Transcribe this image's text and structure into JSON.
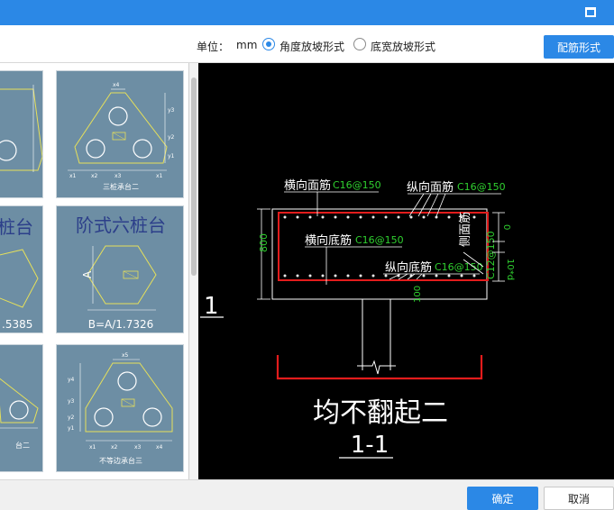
{
  "toolbar": {
    "unit_label": "单位：",
    "unit_value": "mm",
    "option_angle": "角度放坡形式",
    "option_width": "底宽放坡形式",
    "rebar_form_button": "配筋形式"
  },
  "thumbnails": [
    {
      "caption": "",
      "title": ""
    },
    {
      "caption": "三桩承台二",
      "title": ""
    },
    {
      "caption": "",
      "title": "桩台",
      "formula": ".5385"
    },
    {
      "caption": "",
      "title": "阶式六桩台",
      "formula": "B=A/1.7326"
    },
    {
      "caption": "台二",
      "title": ""
    },
    {
      "caption": "不等边承台三",
      "title": ""
    }
  ],
  "cad": {
    "top_transverse": "横向面筋",
    "top_transverse_spec": "C16@150",
    "top_longitudinal": "纵向面筋",
    "top_longitudinal_spec": "C16@150",
    "bottom_transverse": "横向底筋",
    "bottom_transverse_spec": "C16@150",
    "bottom_longitudinal": "纵向底筋",
    "bottom_longitudinal_spec": "C16@150",
    "side_rebar": "侧面筋",
    "side_rebar_spec": "C12@150",
    "height_dim": "800",
    "cover_top": "0",
    "cover_side": "10*d",
    "cover_bottom": "100",
    "section_mark": "1",
    "note": "均不翻起二",
    "section_title": "1-1"
  },
  "footer": {
    "ok": "确定",
    "cancel": "取消"
  }
}
